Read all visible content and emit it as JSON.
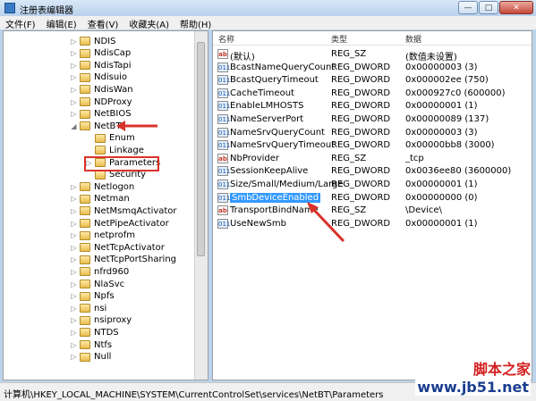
{
  "window": {
    "title": "注册表编辑器",
    "btn_min": "—",
    "btn_max": "□",
    "btn_close": "✕"
  },
  "menu": [
    "文件(F)",
    "编辑(E)",
    "查看(V)",
    "收藏夹(A)",
    "帮助(H)"
  ],
  "tree": [
    {
      "label": "NDIS",
      "exp": "▷"
    },
    {
      "label": "NdisCap",
      "exp": "▷"
    },
    {
      "label": "NdisTapi",
      "exp": "▷"
    },
    {
      "label": "Ndisuio",
      "exp": "▷"
    },
    {
      "label": "NdisWan",
      "exp": "▷"
    },
    {
      "label": "NDProxy",
      "exp": "▷"
    },
    {
      "label": "NetBIOS",
      "exp": "▷"
    },
    {
      "label": "NetBT",
      "exp": "◢"
    },
    {
      "label": "Enum",
      "exp": ""
    },
    {
      "label": "Linkage",
      "exp": ""
    },
    {
      "label": "Parameters",
      "exp": "▷"
    },
    {
      "label": "Security",
      "exp": ""
    },
    {
      "label": "Netlogon",
      "exp": "▷"
    },
    {
      "label": "Netman",
      "exp": "▷"
    },
    {
      "label": "NetMsmqActivator",
      "exp": "▷"
    },
    {
      "label": "NetPipeActivator",
      "exp": "▷"
    },
    {
      "label": "netprofm",
      "exp": "▷"
    },
    {
      "label": "NetTcpActivator",
      "exp": "▷"
    },
    {
      "label": "NetTcpPortSharing",
      "exp": "▷"
    },
    {
      "label": "nfrd960",
      "exp": "▷"
    },
    {
      "label": "NlaSvc",
      "exp": "▷"
    },
    {
      "label": "Npfs",
      "exp": "▷"
    },
    {
      "label": "nsi",
      "exp": "▷"
    },
    {
      "label": "nsiproxy",
      "exp": "▷"
    },
    {
      "label": "NTDS",
      "exp": "▷"
    },
    {
      "label": "Ntfs",
      "exp": "▷"
    },
    {
      "label": "Null",
      "exp": "▷"
    }
  ],
  "list": {
    "headers": {
      "name": "名称",
      "type": "类型",
      "data": "数据"
    },
    "rows": [
      {
        "icon": "ab",
        "name": "(默认)",
        "type": "REG_SZ",
        "data": "(数值未设置)"
      },
      {
        "icon": "011",
        "name": "BcastNameQueryCount",
        "type": "REG_DWORD",
        "data": "0x00000003 (3)"
      },
      {
        "icon": "011",
        "name": "BcastQueryTimeout",
        "type": "REG_DWORD",
        "data": "0x000002ee (750)"
      },
      {
        "icon": "011",
        "name": "CacheTimeout",
        "type": "REG_DWORD",
        "data": "0x000927c0 (600000)"
      },
      {
        "icon": "011",
        "name": "EnableLMHOSTS",
        "type": "REG_DWORD",
        "data": "0x00000001 (1)"
      },
      {
        "icon": "011",
        "name": "NameServerPort",
        "type": "REG_DWORD",
        "data": "0x00000089 (137)"
      },
      {
        "icon": "011",
        "name": "NameSrvQueryCount",
        "type": "REG_DWORD",
        "data": "0x00000003 (3)"
      },
      {
        "icon": "011",
        "name": "NameSrvQueryTimeout",
        "type": "REG_DWORD",
        "data": "0x00000bb8 (3000)"
      },
      {
        "icon": "ab",
        "name": "NbProvider",
        "type": "REG_SZ",
        "data": "_tcp"
      },
      {
        "icon": "011",
        "name": "SessionKeepAlive",
        "type": "REG_DWORD",
        "data": "0x0036ee80 (3600000)"
      },
      {
        "icon": "011",
        "name": "Size/Small/Medium/Large",
        "type": "REG_DWORD",
        "data": "0x00000001 (1)"
      },
      {
        "icon": "011",
        "name": "SmbDeviceEnabled",
        "type": "REG_DWORD",
        "data": "0x00000000 (0)"
      },
      {
        "icon": "ab",
        "name": "TransportBindName",
        "type": "REG_SZ",
        "data": "\\Device\\"
      },
      {
        "icon": "011",
        "name": "UseNewSmb",
        "type": "REG_DWORD",
        "data": "0x00000001 (1)"
      }
    ]
  },
  "status": "计算机\\HKEY_LOCAL_MACHINE\\SYSTEM\\CurrentControlSet\\services\\NetBT\\Parameters",
  "watermark": {
    "top": "脚本之家",
    "bottom": "www.jb51.net"
  },
  "colors": {
    "annotation": "#d9322b",
    "selection": "#3399ff"
  }
}
